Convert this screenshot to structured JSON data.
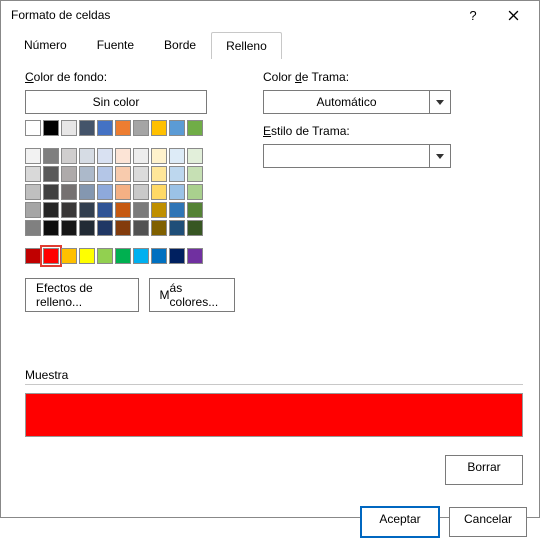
{
  "window": {
    "title": "Formato de celdas"
  },
  "tabs": {
    "t1": "Número",
    "t2": "Fuente",
    "t3": "Borde",
    "t4": "Relleno"
  },
  "fill": {
    "label_pre": "",
    "label_u": "C",
    "label_post": "olor de fondo:",
    "noColor": "Sin color",
    "row_a": [
      "#ffffff",
      "#000000",
      "#e7e6e6",
      "#44546a",
      "#4472c4",
      "#ed7d31",
      "#a5a5a5",
      "#ffc000",
      "#5b9bd5",
      "#70ad47"
    ],
    "theme": [
      [
        "#f2f2f2",
        "#7f7f7f",
        "#d0cece",
        "#d6dce4",
        "#d9e1f2",
        "#fce4d6",
        "#ededed",
        "#fff2cc",
        "#ddebf7",
        "#e2efda"
      ],
      [
        "#d9d9d9",
        "#595959",
        "#aeaaaa",
        "#acb9ca",
        "#b4c6e7",
        "#f8cbad",
        "#dbdbdb",
        "#ffe699",
        "#bdd7ee",
        "#c6e0b4"
      ],
      [
        "#bfbfbf",
        "#404040",
        "#757171",
        "#8497b0",
        "#8ea9db",
        "#f4b084",
        "#c9c9c9",
        "#ffd966",
        "#9bc2e6",
        "#a9d08e"
      ],
      [
        "#a6a6a6",
        "#262626",
        "#3a3838",
        "#333f4f",
        "#305496",
        "#c65911",
        "#7b7b7b",
        "#bf8f00",
        "#2f75b5",
        "#548235"
      ],
      [
        "#808080",
        "#0d0d0d",
        "#161616",
        "#222b35",
        "#203764",
        "#833c0c",
        "#525252",
        "#806000",
        "#1f4e78",
        "#375623"
      ]
    ],
    "std": [
      "#c00000",
      "#ff0000",
      "#ffc000",
      "#ffff00",
      "#92d050",
      "#00b050",
      "#00b0f0",
      "#0070c0",
      "#002060",
      "#7030a0"
    ],
    "selected_index": 1
  },
  "buttons": {
    "effects": "Efectos de relleno...",
    "more_pre": "",
    "more_u": "M",
    "more_post": "ás colores..."
  },
  "pattern": {
    "color_pre": "Color ",
    "color_u": "d",
    "color_post": "e Trama:",
    "color_value": "Automático",
    "style_pre": "",
    "style_u": "E",
    "style_post": "stilo de Trama:",
    "style_value": ""
  },
  "sample": {
    "label": "Muestra",
    "color": "#ff0000"
  },
  "actions": {
    "clear_u": "B",
    "clear_post": "orrar",
    "ok": "Aceptar",
    "cancel": "Cancelar"
  }
}
